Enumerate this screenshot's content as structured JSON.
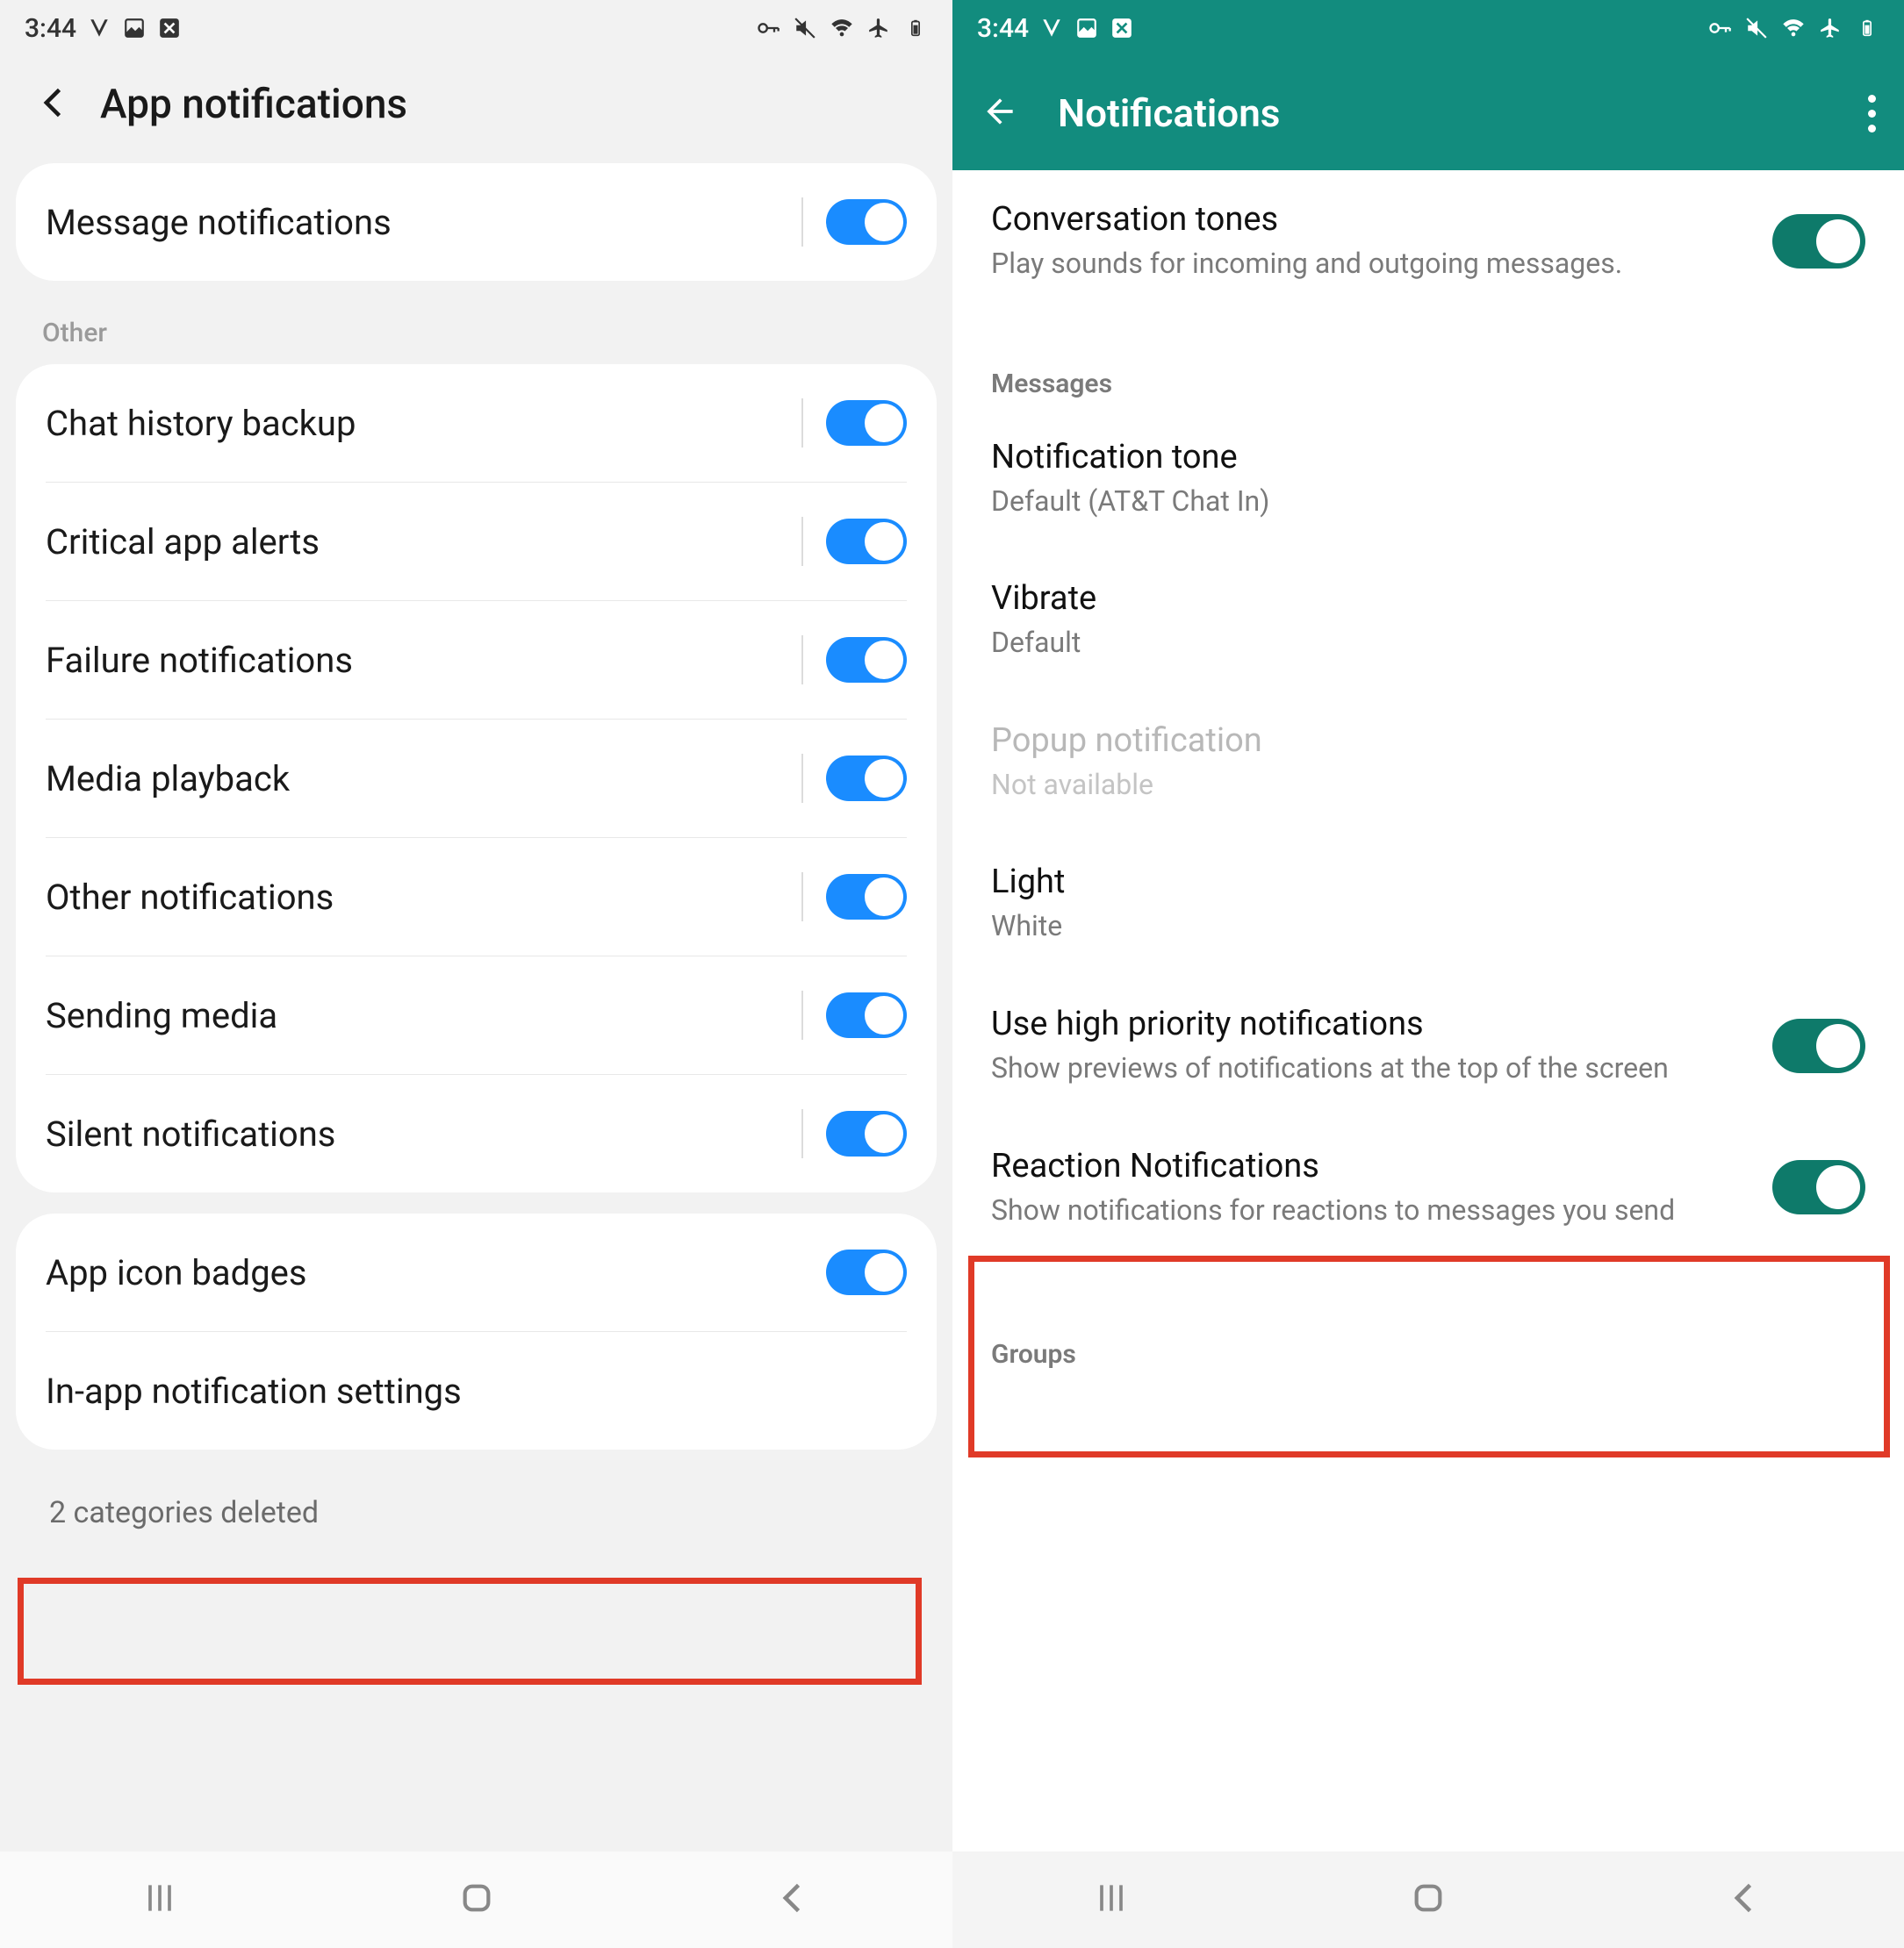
{
  "left": {
    "status_time": "3:44",
    "appbar_title": "App notifications",
    "card1": {
      "row0_label": "Message notifications"
    },
    "section_other": "Other",
    "card2": {
      "r0": "Chat history backup",
      "r1": "Critical app alerts",
      "r2": "Failure notifications",
      "r3": "Media playback",
      "r4": "Other notifications",
      "r5": "Sending media",
      "r6": "Silent notifications"
    },
    "card3": {
      "r0": "App icon badges",
      "r1": "In-app notification settings"
    },
    "footer": "2 categories deleted"
  },
  "right": {
    "status_time": "3:44",
    "appbar_title": "Notifications",
    "conv_title": "Conversation tones",
    "conv_sub": "Play sounds for incoming and outgoing messages.",
    "sec_messages": "Messages",
    "notif_tone_title": "Notification tone",
    "notif_tone_sub": "Default (AT&T Chat In)",
    "vibrate_title": "Vibrate",
    "vibrate_sub": "Default",
    "popup_title": "Popup notification",
    "popup_sub": "Not available",
    "light_title": "Light",
    "light_sub": "White",
    "hipri_title": "Use high priority notifications",
    "hipri_sub": "Show previews of notifications at the top of the screen",
    "react_title": "Reaction Notifications",
    "react_sub": "Show notifications for reactions to messages you send",
    "sec_groups": "Groups"
  }
}
